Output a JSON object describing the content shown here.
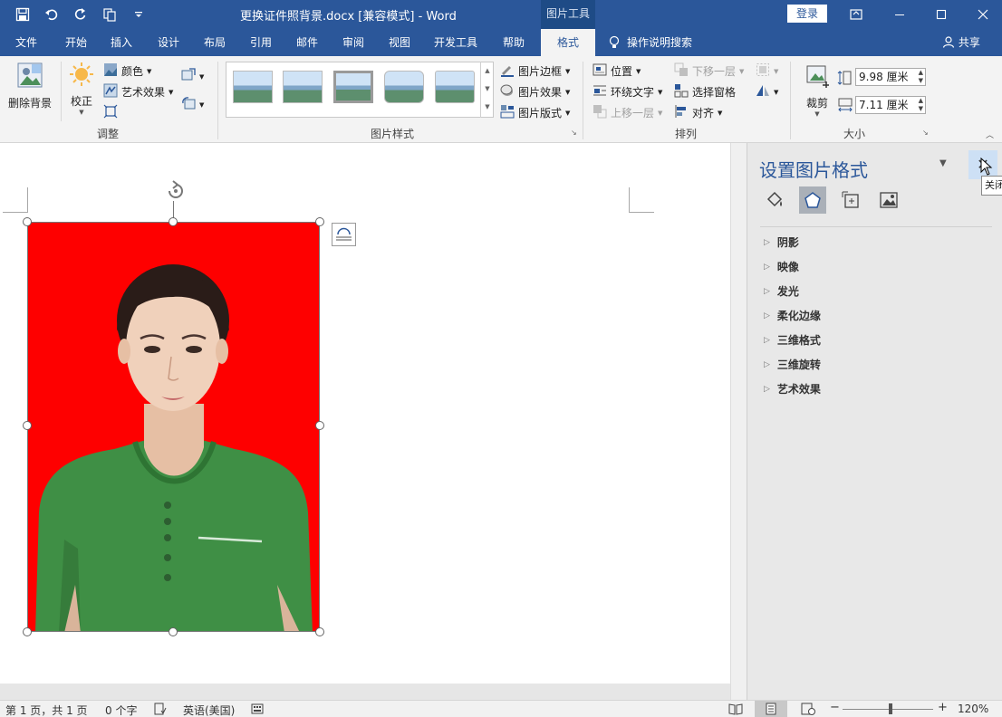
{
  "title_bar": {
    "doc_title": "更换证件照背景.docx [兼容模式]  -  Word",
    "tools_tab": "图片工具",
    "login": "登录",
    "qat": [
      "save-icon",
      "undo-icon",
      "redo-icon",
      "touch-mode-icon",
      "customize-icon"
    ]
  },
  "tabs": {
    "items": [
      "文件",
      "开始",
      "插入",
      "设计",
      "布局",
      "引用",
      "邮件",
      "审阅",
      "视图",
      "开发工具",
      "帮助",
      "格式"
    ],
    "active": "格式",
    "tell_me": "操作说明搜索",
    "share": "共享"
  },
  "ribbon": {
    "adjust": {
      "remove_bg": "删除背景",
      "correct": "校正",
      "color": "颜色",
      "artistic": "艺术效果",
      "label": "调整"
    },
    "styles": {
      "border": "图片边框",
      "effects": "图片效果",
      "layout": "图片版式",
      "label": "图片样式"
    },
    "arrange": {
      "position": "位置",
      "wrap": "环绕文字",
      "bring_forward": "上移一层",
      "send_backward": "下移一层",
      "selection_pane": "选择窗格",
      "align": "对齐",
      "label": "排列"
    },
    "size": {
      "crop": "裁剪",
      "height": "9.98 厘米",
      "width": "7.11 厘米",
      "label": "大小"
    }
  },
  "pane": {
    "title": "设置图片格式",
    "close_tooltip": "关闭",
    "icons": [
      "fill-line-icon",
      "effects-icon",
      "size-properties-icon",
      "picture-icon"
    ],
    "items": [
      "阴影",
      "映像",
      "发光",
      "柔化边缘",
      "三维格式",
      "三维旋转",
      "艺术效果"
    ]
  },
  "status": {
    "page": "第 1 页，共 1 页",
    "words": "0 个字",
    "language": "英语(美国)",
    "zoom": "120%"
  },
  "colors": {
    "brand": "#2b579a",
    "picture_background": "#fe0000",
    "shirt": "#3f8f45"
  }
}
